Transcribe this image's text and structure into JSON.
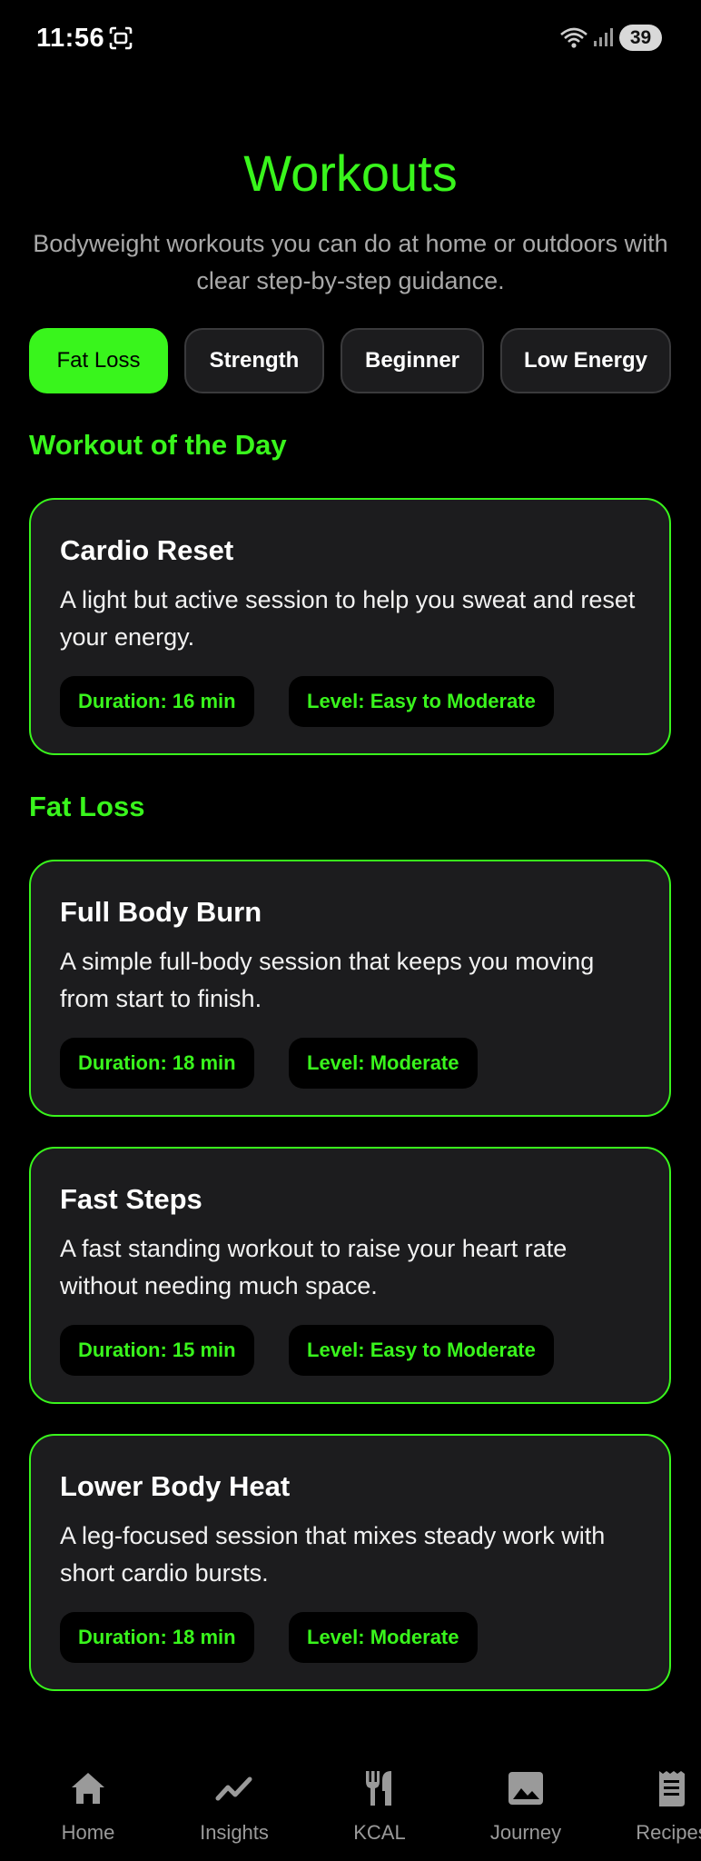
{
  "status_bar": {
    "time": "11:56",
    "battery": "39"
  },
  "header": {
    "title": "Workouts",
    "subtitle": "Bodyweight workouts you can do at home or outdoors with clear step-by-step guidance."
  },
  "filters": [
    {
      "label": "Fat Loss",
      "active": true
    },
    {
      "label": "Strength",
      "active": false
    },
    {
      "label": "Beginner",
      "active": false
    },
    {
      "label": "Low Energy",
      "active": false
    }
  ],
  "workout_of_the_day": {
    "section_title": "Workout of the Day",
    "card": {
      "title": "Cardio Reset",
      "description": "A light but active session to help you sweat and reset your energy.",
      "duration": "Duration: 16 min",
      "level": "Level: Easy to Moderate"
    }
  },
  "fat_loss": {
    "section_title": "Fat Loss",
    "cards": [
      {
        "title": "Full Body Burn",
        "description": "A simple full-body session that keeps you moving from start to finish.",
        "duration": "Duration: 18 min",
        "level": "Level: Moderate"
      },
      {
        "title": "Fast Steps",
        "description": "A fast standing workout to raise your heart rate without needing much space.",
        "duration": "Duration: 15 min",
        "level": "Level: Easy to Moderate"
      },
      {
        "title": "Lower Body Heat",
        "description": "A leg-focused session that mixes steady work with short cardio bursts.",
        "duration": "Duration: 18 min",
        "level": "Level: Moderate"
      }
    ]
  },
  "bottom_nav": [
    {
      "label": "Home",
      "icon": "home-icon"
    },
    {
      "label": "Insights",
      "icon": "trend-icon"
    },
    {
      "label": "KCAL",
      "icon": "fork-knife-icon"
    },
    {
      "label": "Journey",
      "icon": "image-icon"
    },
    {
      "label": "Recipes",
      "icon": "receipt-icon"
    }
  ],
  "colors": {
    "accent": "#39f51c",
    "card_background": "#1c1c1e",
    "background": "#000000"
  }
}
